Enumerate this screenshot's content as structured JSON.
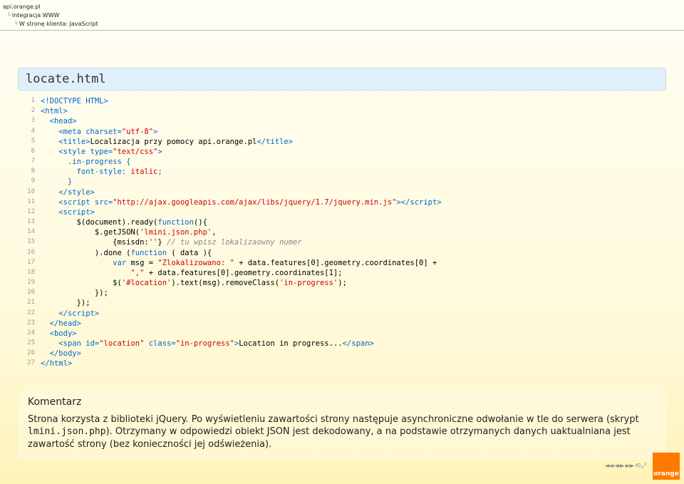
{
  "breadcrumbs": {
    "l1": "api.orange.pl",
    "l2": "Integracja WWW",
    "l3": "W stronę klienta: JavaScript"
  },
  "title": "locate.html",
  "code": [
    [
      {
        "t": "<!DOCTYPE HTML>",
        "c": "blue"
      }
    ],
    [
      {
        "t": "<html>",
        "c": "blue"
      }
    ],
    [
      {
        "t": "  ",
        "c": ""
      },
      {
        "t": "<head>",
        "c": "blue"
      }
    ],
    [
      {
        "t": "    ",
        "c": ""
      },
      {
        "t": "<meta charset=",
        "c": "blue"
      },
      {
        "t": "\"utf-8\"",
        "c": "red"
      },
      {
        "t": ">",
        "c": "blue"
      }
    ],
    [
      {
        "t": "    ",
        "c": ""
      },
      {
        "t": "<title>",
        "c": "blue"
      },
      {
        "t": "Localizacja przy pomocy api.orange.pl",
        "c": ""
      },
      {
        "t": "</title>",
        "c": "blue"
      }
    ],
    [
      {
        "t": "    ",
        "c": ""
      },
      {
        "t": "<style type=",
        "c": "blue"
      },
      {
        "t": "\"text/css\"",
        "c": "red"
      },
      {
        "t": ">",
        "c": "blue"
      }
    ],
    [
      {
        "t": "      .in-progress {",
        "c": "blue"
      }
    ],
    [
      {
        "t": "        font-style: ",
        "c": "blue"
      },
      {
        "t": "italic",
        "c": "red"
      },
      {
        "t": ";",
        "c": "blue"
      }
    ],
    [
      {
        "t": "      }",
        "c": "blue"
      }
    ],
    [
      {
        "t": "    ",
        "c": ""
      },
      {
        "t": "</style>",
        "c": "blue"
      }
    ],
    [
      {
        "t": "    ",
        "c": ""
      },
      {
        "t": "<script src=",
        "c": "blue"
      },
      {
        "t": "\"http://ajax.googleapis.com/ajax/libs/jquery/1.7/jquery.min.js\"",
        "c": "red"
      },
      {
        "t": "></scr",
        "c": "blue"
      },
      {
        "t": "ipt>",
        "c": "blue"
      }
    ],
    [
      {
        "t": "    ",
        "c": ""
      },
      {
        "t": "<script>",
        "c": "blue"
      }
    ],
    [
      {
        "t": "        $(document).ready(",
        "c": ""
      },
      {
        "t": "function",
        "c": "blue"
      },
      {
        "t": "(){",
        "c": ""
      }
    ],
    [
      {
        "t": "            $.getJSON(",
        "c": ""
      },
      {
        "t": "'lmini.json.php'",
        "c": "red"
      },
      {
        "t": ",",
        "c": ""
      }
    ],
    [
      {
        "t": "                {msisdn:",
        "c": ""
      },
      {
        "t": "''",
        "c": "red"
      },
      {
        "t": "} ",
        "c": ""
      },
      {
        "t": "// tu wpisz lokalizaowny numer",
        "c": "grey"
      }
    ],
    [
      {
        "t": "            ).done (",
        "c": ""
      },
      {
        "t": "function",
        "c": "blue"
      },
      {
        "t": " ( data ){",
        "c": ""
      }
    ],
    [
      {
        "t": "                ",
        "c": ""
      },
      {
        "t": "var",
        "c": "blue"
      },
      {
        "t": " msg = ",
        "c": ""
      },
      {
        "t": "\"Zlokalizowano: \"",
        "c": "red"
      },
      {
        "t": " + data.features[0].geometry.coordinates[0] +",
        "c": ""
      }
    ],
    [
      {
        "t": "                    ",
        "c": ""
      },
      {
        "t": "\",\"",
        "c": "red"
      },
      {
        "t": " + data.features[0].geometry.coordinates[1];",
        "c": ""
      }
    ],
    [
      {
        "t": "                $(",
        "c": ""
      },
      {
        "t": "'#location'",
        "c": "red"
      },
      {
        "t": ").text(msg).removeClass(",
        "c": ""
      },
      {
        "t": "'in-progress'",
        "c": "red"
      },
      {
        "t": ");",
        "c": ""
      }
    ],
    [
      {
        "t": "            });",
        "c": ""
      }
    ],
    [
      {
        "t": "        });",
        "c": ""
      }
    ],
    [
      {
        "t": "    ",
        "c": ""
      },
      {
        "t": "</scr",
        "c": "blue"
      },
      {
        "t": "ipt>",
        "c": "blue"
      }
    ],
    [
      {
        "t": "  ",
        "c": ""
      },
      {
        "t": "</head>",
        "c": "blue"
      }
    ],
    [
      {
        "t": "  ",
        "c": ""
      },
      {
        "t": "<body>",
        "c": "blue"
      }
    ],
    [
      {
        "t": "    ",
        "c": ""
      },
      {
        "t": "<span id=",
        "c": "blue"
      },
      {
        "t": "\"location\"",
        "c": "red"
      },
      {
        "t": " class=",
        "c": "blue"
      },
      {
        "t": "\"in-progress\"",
        "c": "red"
      },
      {
        "t": ">",
        "c": "blue"
      },
      {
        "t": "Location in progress...",
        "c": ""
      },
      {
        "t": "</span>",
        "c": "blue"
      }
    ],
    [
      {
        "t": "  ",
        "c": ""
      },
      {
        "t": "</body>",
        "c": "blue"
      }
    ],
    [
      {
        "t": "</html>",
        "c": "blue"
      }
    ]
  ],
  "commentary": {
    "heading": "Komentarz",
    "body_parts": [
      {
        "t": "Strona korzysta z biblioteki jQuery. Po wyświetleniu zawartości strony następuje asynchroniczne odwołanie w tle do serwera (skrypt ",
        "c": ""
      },
      {
        "t": "lmini.json.php",
        "c": "mono"
      },
      {
        "t": "). Otrzymany w odpowiedzi obiekt JSON jest dekodowany, a na podstawie otrzymanych danych uaktualniana jest zawartość strony (bez konieczności jej odświeżenia).",
        "c": ""
      }
    ]
  },
  "footer": {
    "logo": "orange"
  }
}
